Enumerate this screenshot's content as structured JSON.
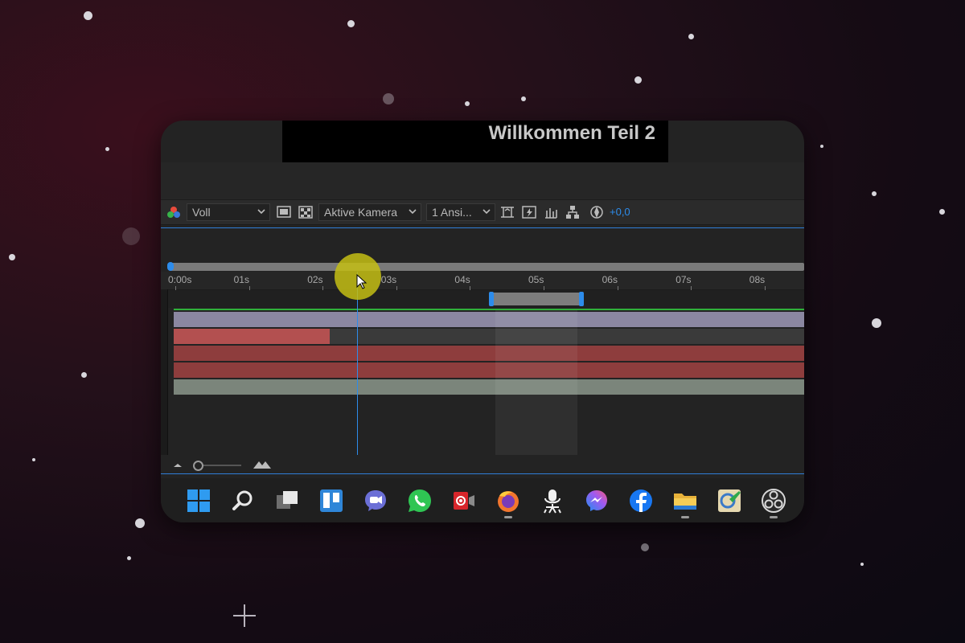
{
  "video": {
    "title": "Willkommen Teil 2"
  },
  "viewer_toolbar": {
    "resolution": "Voll",
    "camera": "Aktive Kamera",
    "views": "1 Ansi...",
    "exposure": "+0,0",
    "icons": [
      "color-channels-icon",
      "region-of-interest-icon",
      "transparency-grid-icon",
      "reset-camera-icon",
      "fast-preview-icon",
      "snapshot-icon",
      "flowchart-icon",
      "reset-exposure-icon"
    ]
  },
  "timeline": {
    "ruler_labels": [
      "0:00s",
      "01s",
      "02s",
      "03s",
      "04s",
      "05s",
      "06s",
      "07s",
      "08s"
    ],
    "playhead_seconds": 2.5,
    "layer_colors": [
      "#8b87a1",
      "#b35050",
      "#8e3d3d",
      "#8e3d3d",
      "#7b857b"
    ],
    "accent": "#2d8ceb",
    "green": "#2fb03a"
  },
  "taskbar": {
    "apps": [
      "windows-start",
      "search",
      "task-view",
      "trello",
      "teams-chat",
      "whatsapp",
      "screen-recorder",
      "firefox",
      "tts-app",
      "messenger",
      "facebook",
      "file-explorer",
      "paint-app",
      "obs-studio"
    ]
  }
}
